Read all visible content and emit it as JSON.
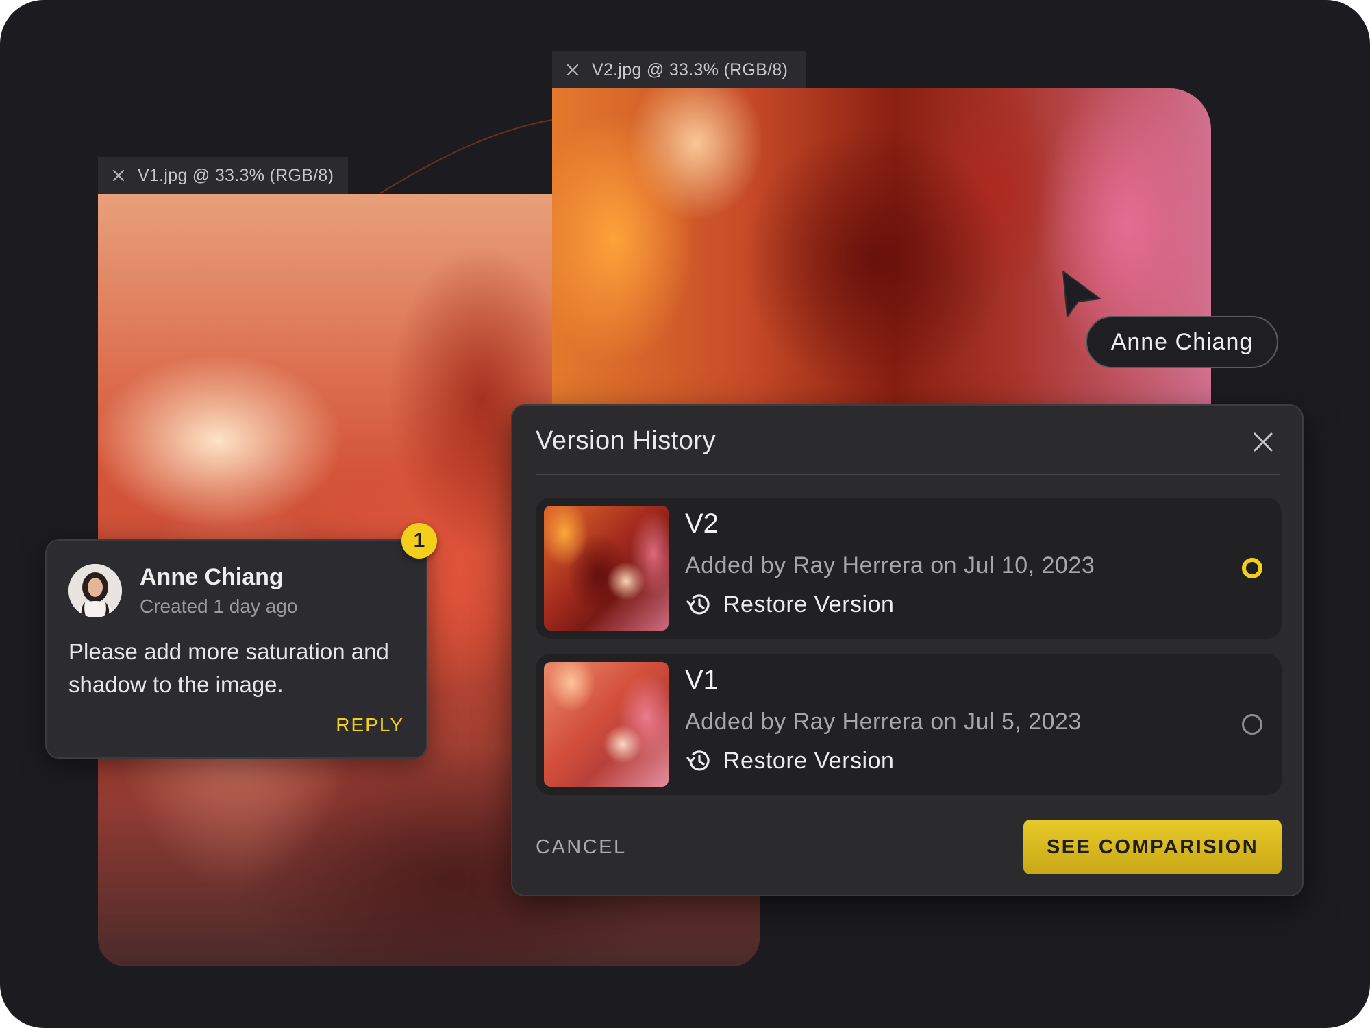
{
  "documents": {
    "v1": {
      "tab_label": "V1.jpg @ 33.3% (RGB/8)"
    },
    "v2": {
      "tab_label": "V2.jpg @ 33.3% (RGB/8)"
    }
  },
  "comment": {
    "badge_count": "1",
    "author": "Anne Chiang",
    "time": "Created 1 day ago",
    "text": "Please add more saturation and shadow to the image.",
    "reply_label": "REPLY"
  },
  "cursor": {
    "user_name": "Anne Chiang"
  },
  "version_history": {
    "title": "Version History",
    "versions": [
      {
        "name": "V2",
        "meta": "Added by Ray Herrera on Jul 10, 2023",
        "restore_label": "Restore Version",
        "selected": true
      },
      {
        "name": "V1",
        "meta": "Added by Ray Herrera on Jul 5, 2023",
        "restore_label": "Restore Version",
        "selected": false
      }
    ],
    "cancel_label": "CANCEL",
    "compare_label": "SEE COMPARISION"
  },
  "colors": {
    "accent": "#f2cf1a",
    "background": "#1c1c20",
    "panel": "#2b2b2e"
  },
  "icons": {
    "tab_close": "close-icon",
    "panel_close": "close-icon",
    "restore": "history-icon",
    "cursor": "cursor-arrow-icon"
  }
}
